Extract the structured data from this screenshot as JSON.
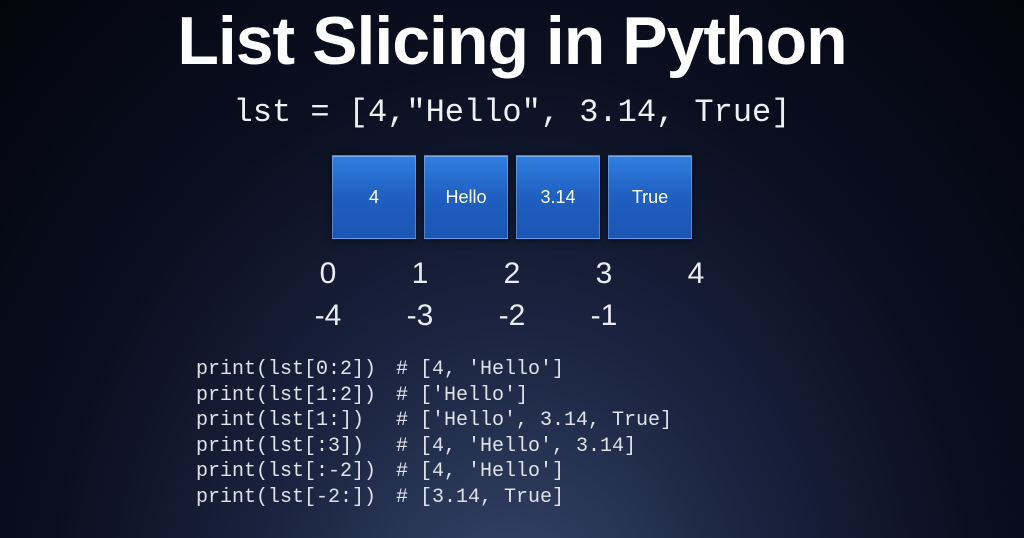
{
  "title": "List Slicing in Python",
  "declaration": "lst = [4,\"Hello\", 3.14, True]",
  "boxes": [
    "4",
    "Hello",
    "3.14",
    "True"
  ],
  "positive_indices": [
    "0",
    "1",
    "2",
    "3",
    "4"
  ],
  "negative_indices": [
    "-4",
    "-3",
    "-2",
    "-1",
    ""
  ],
  "slices": [
    {
      "call": "print(lst[0:2])",
      "result": "# [4, 'Hello']"
    },
    {
      "call": "print(lst[1:2])",
      "result": "# ['Hello']"
    },
    {
      "call": "print(lst[1:])",
      "result": "# ['Hello', 3.14, True]"
    },
    {
      "call": "print(lst[:3])",
      "result": "# [4, 'Hello', 3.14]"
    },
    {
      "call": "print(lst[:-2])",
      "result": "# [4, 'Hello']"
    },
    {
      "call": "print(lst[-2:])",
      "result": "# [3.14, True]"
    }
  ]
}
